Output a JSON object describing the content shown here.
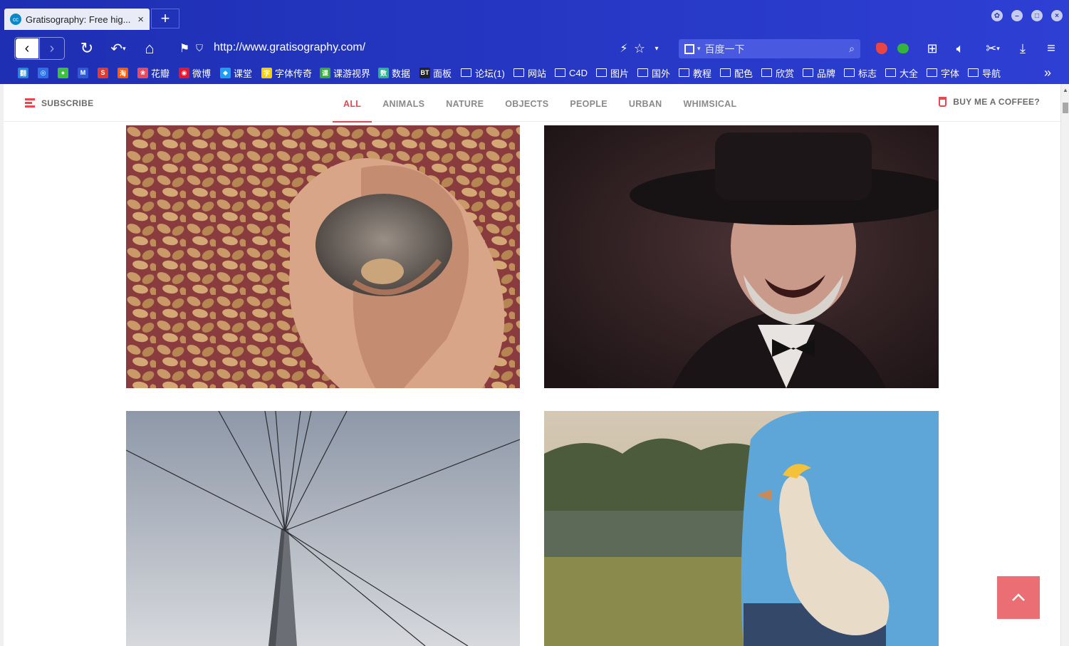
{
  "browser": {
    "tab_title": "Gratisography: Free hig...",
    "tab_favicon": "cc",
    "tab_close": "×",
    "new_tab": "+",
    "url": "http://www.gratisography.com/",
    "search_placeholder": "百度一下",
    "bookmarks": [
      {
        "label": "",
        "icon": "翻",
        "color": "#1b8ae0"
      },
      {
        "label": "",
        "icon": "◎",
        "color": "#2f6fe6"
      },
      {
        "label": "",
        "icon": "●",
        "color": "#3fbf3f"
      },
      {
        "label": "",
        "icon": "M",
        "color": "#2f5ad6"
      },
      {
        "label": "",
        "icon": "S",
        "color": "#e03b2e"
      },
      {
        "label": "",
        "icon": "淘",
        "color": "#ff5a00"
      },
      {
        "label": "花瓣",
        "icon": "❀",
        "color": "#e84a5f"
      },
      {
        "label": "微博",
        "icon": "◉",
        "color": "#e6162d"
      },
      {
        "label": "课堂",
        "icon": "◆",
        "color": "#1e9ef0"
      },
      {
        "label": "字体传奇",
        "icon": "字",
        "color": "#f5d000"
      },
      {
        "label": "课游视界",
        "icon": "课",
        "color": "#3aa93a"
      },
      {
        "label": "数据",
        "icon": "数",
        "color": "#27b58f"
      },
      {
        "label": "面板",
        "icon": "BT",
        "color": "#222222"
      },
      {
        "label": "论坛(1)",
        "icon": "folder"
      },
      {
        "label": "网站",
        "icon": "folder"
      },
      {
        "label": "C4D",
        "icon": "folder"
      },
      {
        "label": "图片",
        "icon": "folder"
      },
      {
        "label": "国外",
        "icon": "folder"
      },
      {
        "label": "教程",
        "icon": "folder"
      },
      {
        "label": "配色",
        "icon": "folder"
      },
      {
        "label": "欣赏",
        "icon": "folder"
      },
      {
        "label": "品牌",
        "icon": "folder"
      },
      {
        "label": "标志",
        "icon": "folder"
      },
      {
        "label": "大全",
        "icon": "folder"
      },
      {
        "label": "字体",
        "icon": "folder"
      },
      {
        "label": "导航",
        "icon": "folder"
      }
    ],
    "more_bookmarks": "»"
  },
  "site": {
    "subscribe": "SUBSCRIBE",
    "categories": [
      "ALL",
      "ANIMALS",
      "NATURE",
      "OBJECTS",
      "PEOPLE",
      "URBAN",
      "WHIMSICAL"
    ],
    "active_category": "ALL",
    "coffee": "BUY ME A COFFEE?",
    "accent_color": "#e8474f",
    "back_to_top": "^"
  },
  "photos": [
    {
      "name": "photo-baby-squirrel-peanuts"
    },
    {
      "name": "photo-old-man-top-hat"
    },
    {
      "name": "photo-bridge-cables-sky"
    },
    {
      "name": "photo-man-holding-duck"
    }
  ]
}
